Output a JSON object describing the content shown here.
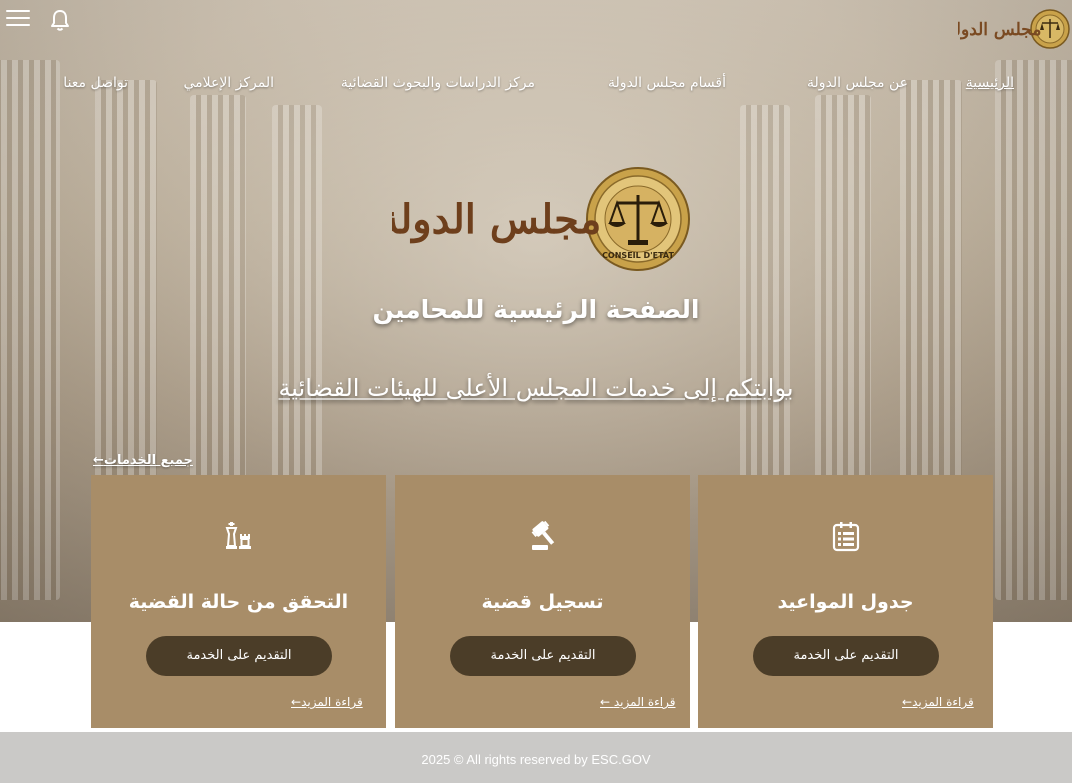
{
  "header": {
    "menu_icon": "hamburger-menu-icon",
    "bell_icon": "bell-icon",
    "logo_text": "مجلس الدولة",
    "seal_text": "CONSEIL D'ETAT"
  },
  "nav": {
    "items": [
      {
        "label": "الرئيسية"
      },
      {
        "label": "عن مجلس الدولة"
      },
      {
        "label": "أقسام مجلس الدولة"
      },
      {
        "label": "مركز الدراسات والبحوث القضائية"
      },
      {
        "label": "المركز الإعلامي"
      },
      {
        "label": "تواصل معنا"
      }
    ]
  },
  "hero": {
    "logo_text": "مجلس الدولة",
    "title": "الصفحة الرئيسية للمحامين",
    "subtitle": "بوابتكم إلى خدمات المجلس الأعلى للهيئات القضائية"
  },
  "services": {
    "all_link": "←جميع الخدمات",
    "cards": [
      {
        "icon": "chess-pieces-icon",
        "title": "التحقق من حالة القضية",
        "button": "التقديم على الخدمة",
        "more": "←قراءة المزيد"
      },
      {
        "icon": "gavel-icon",
        "title": "تسجيل قضية",
        "button": "التقديم على الخدمة",
        "more": "←  قراءة المزيد"
      },
      {
        "icon": "calendar-list-icon",
        "title": "جدول المواعيد",
        "button": "التقديم على الخدمة",
        "more": "←قراءة المزيد"
      }
    ]
  },
  "footer": {
    "text": "2025 © All rights reserved by ESC.GOV"
  },
  "colors": {
    "card": "#a88d68",
    "button": "#4b3d28",
    "footer": "#cac9c7",
    "logo": "#7a4a22"
  }
}
